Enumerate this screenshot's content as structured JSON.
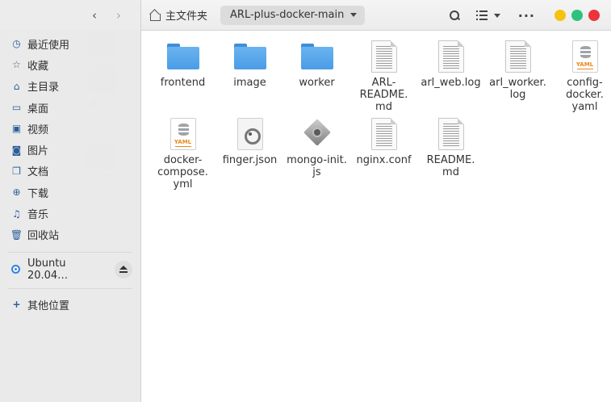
{
  "window": {
    "home_label": "主文件夹",
    "current_folder": "ARL-plus-docker-main"
  },
  "icons": {
    "back": "chevron-left-icon",
    "forward": "chevron-right-icon",
    "home": "home-icon",
    "search": "search-icon",
    "view": "list-view-icon",
    "menu": "more-dots-icon"
  },
  "colors": {
    "folder": "#4a9ce6",
    "minimize": "#f5c211",
    "maximize": "#2ec27e",
    "close": "#ed333b",
    "accent": "#3584e4"
  },
  "sidebar": {
    "items": [
      {
        "label": "最近使用",
        "icon": "clock-icon"
      },
      {
        "label": "收藏",
        "icon": "star-icon"
      },
      {
        "label": "主目录",
        "icon": "home-icon"
      },
      {
        "label": "桌面",
        "icon": "desktop-icon"
      },
      {
        "label": "视频",
        "icon": "video-icon"
      },
      {
        "label": "图片",
        "icon": "picture-icon"
      },
      {
        "label": "文档",
        "icon": "document-icon"
      },
      {
        "label": "下载",
        "icon": "download-icon"
      },
      {
        "label": "音乐",
        "icon": "music-icon"
      },
      {
        "label": "回收站",
        "icon": "trash-icon"
      }
    ],
    "device": {
      "label": "Ubuntu 20.04…",
      "icon": "disc-icon"
    },
    "other": {
      "label": "其他位置",
      "icon": "plus-icon"
    }
  },
  "files": [
    {
      "name": "frontend",
      "type": "folder"
    },
    {
      "name": "image",
      "type": "folder"
    },
    {
      "name": "worker",
      "type": "folder"
    },
    {
      "name": "ARL-README.md",
      "display": "ARL-\nREADME.\nmd",
      "type": "text"
    },
    {
      "name": "arl_web.log",
      "display": "arl_web.log",
      "type": "text"
    },
    {
      "name": "arl_worker.log",
      "display": "arl_worker.\nlog",
      "type": "text"
    },
    {
      "name": "config-docker.yaml",
      "display": "config-\ndocker.\nyaml",
      "type": "yaml"
    },
    {
      "name": "docker-compose.yml",
      "display": "docker-\ncompose.\nyml",
      "type": "yaml"
    },
    {
      "name": "finger.json",
      "display": "finger.json",
      "type": "json"
    },
    {
      "name": "mongo-init.js",
      "display": "mongo-init.\njs",
      "type": "script"
    },
    {
      "name": "nginx.conf",
      "display": "nginx.conf",
      "type": "text"
    },
    {
      "name": "README.md",
      "display": "README.\nmd",
      "type": "text"
    }
  ],
  "yaml_tag": "YAML"
}
